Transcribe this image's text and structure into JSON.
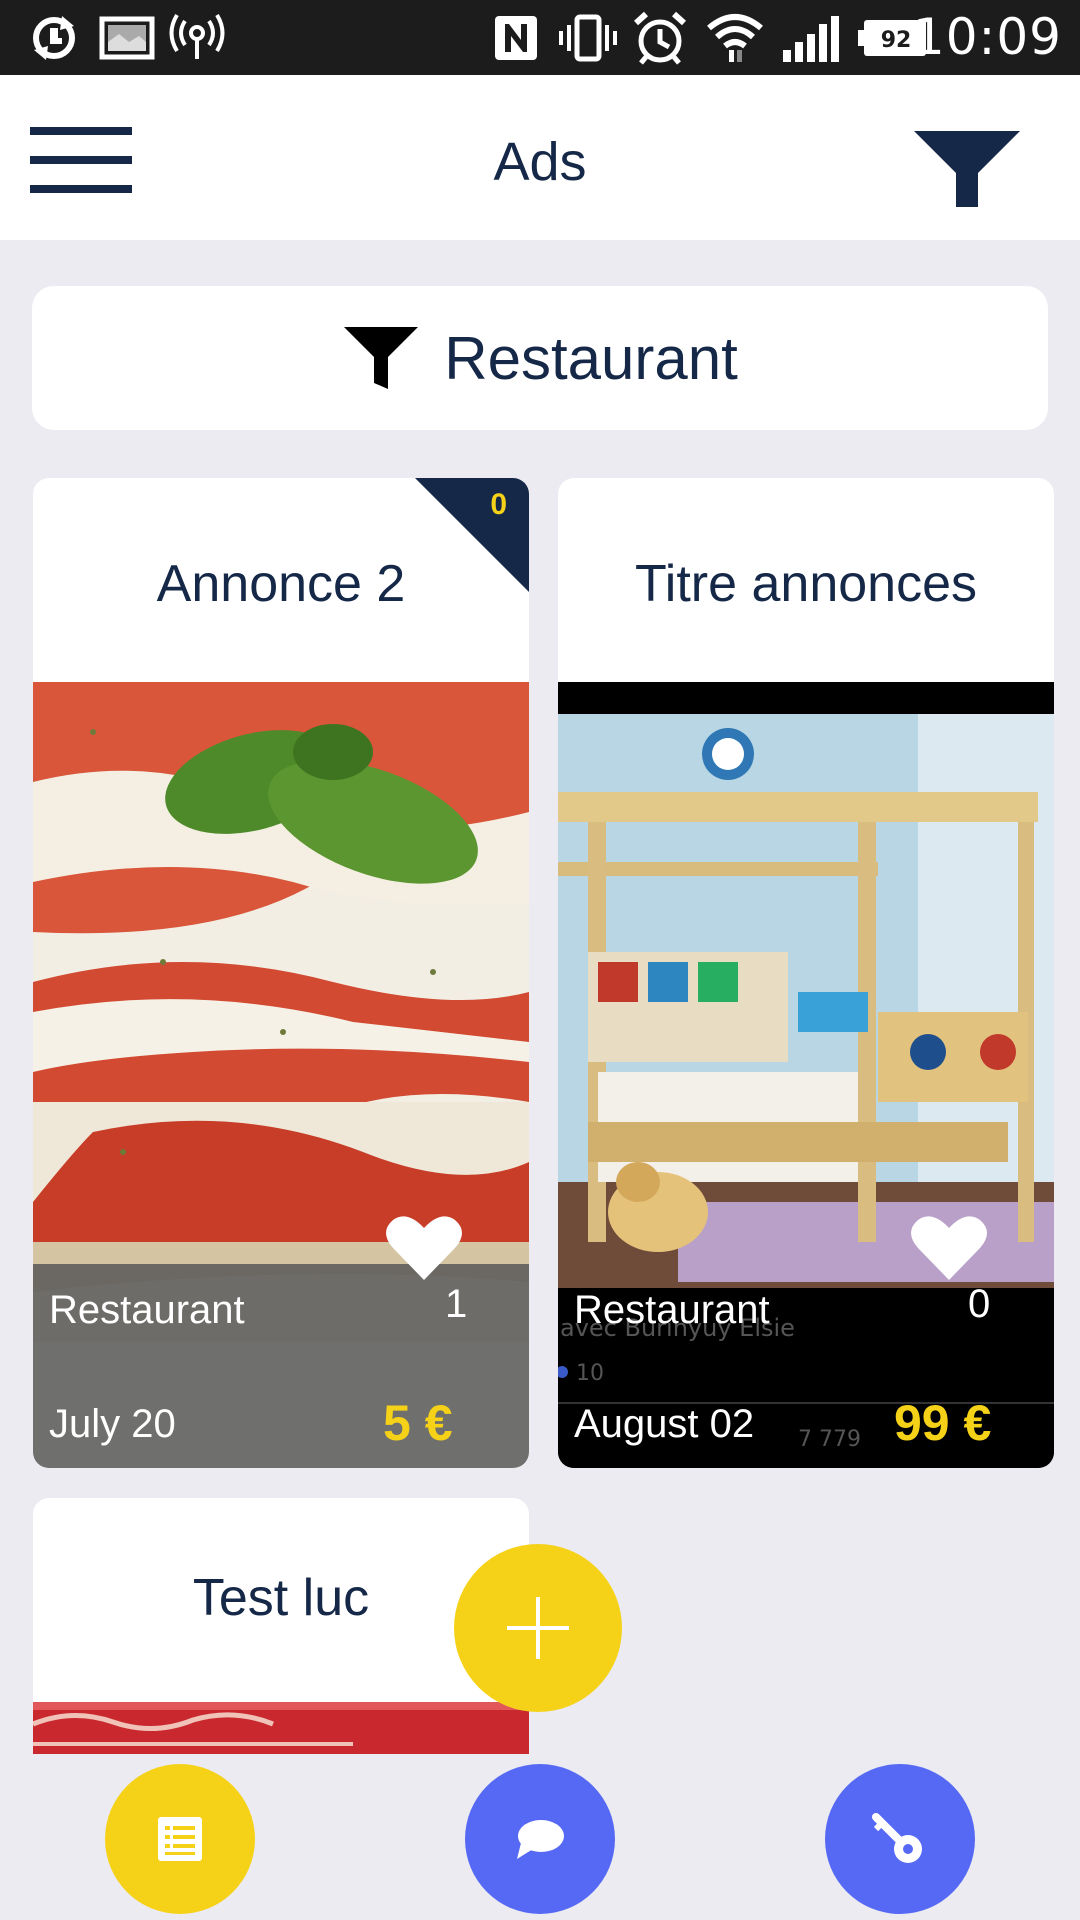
{
  "status_bar": {
    "time": "10:09",
    "battery_level": "92",
    "icons": [
      "sync-icon",
      "image-icon",
      "hotspot-icon",
      "nfc-icon",
      "vibrate-icon",
      "alarm-icon",
      "wifi-icon",
      "signal-icon",
      "battery-icon"
    ]
  },
  "header": {
    "title": "Ads",
    "menu_icon": "hamburger-icon",
    "filter_icon": "filter-icon"
  },
  "filter_chip": {
    "label": "Restaurant",
    "icon": "filter-icon"
  },
  "ads": [
    {
      "title": "Annonce 2",
      "badge_count": "0",
      "category": "Restaurant",
      "likes": "1",
      "date": "July  20",
      "price": "5 €",
      "image": "pizza-photo"
    },
    {
      "title": "Titre annonces",
      "category": "Restaurant",
      "likes": "0",
      "date": "August  02",
      "price": "99 €",
      "image": "bunk-bed-photo",
      "image_overlay_text": {
        "caption": "avec Burinyuy Elsie",
        "count_a": "10",
        "count_b": "7 779"
      }
    },
    {
      "title": "Test luc",
      "image": "red-banner-photo"
    }
  ],
  "fab": {
    "icon": "plus-icon"
  },
  "bottom_nav": [
    {
      "icon": "list-icon",
      "color": "#f5d218"
    },
    {
      "icon": "chat-icon",
      "color": "#5569f5"
    },
    {
      "icon": "key-icon",
      "color": "#5569f5"
    }
  ],
  "colors": {
    "accent": "#f5d218",
    "primary": "#152848",
    "nav_blue": "#5569f5",
    "background": "#ebebf1"
  }
}
